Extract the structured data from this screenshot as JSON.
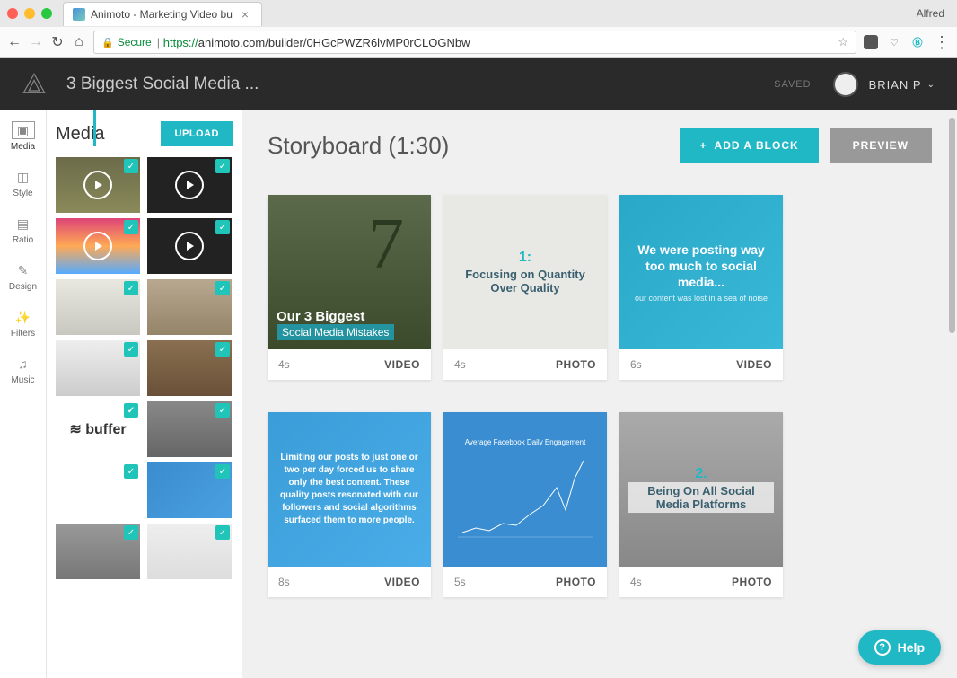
{
  "browser": {
    "tab_title": "Animoto - Marketing Video bu",
    "profile": "Alfred",
    "secure_label": "Secure",
    "url_scheme": "https://",
    "url_rest": "animoto.com/builder/0HGcPWZR6lvMP0rCLOGNbw"
  },
  "header": {
    "project_title": "3 Biggest Social Media ...",
    "saved_label": "SAVED",
    "username": "BRIAN P"
  },
  "leftnav": {
    "items": [
      {
        "label": "Media",
        "icon": "image-icon"
      },
      {
        "label": "Style",
        "icon": "frame-icon"
      },
      {
        "label": "Ratio",
        "icon": "ratio-icon"
      },
      {
        "label": "Design",
        "icon": "brush-icon"
      },
      {
        "label": "Filters",
        "icon": "wand-icon"
      },
      {
        "label": "Music",
        "icon": "music-icon"
      }
    ]
  },
  "media_panel": {
    "title": "Media",
    "upload_label": "UPLOAD",
    "thumbs": [
      {
        "type": "video",
        "cls": "t-film"
      },
      {
        "type": "video",
        "cls": "t-dark"
      },
      {
        "type": "video",
        "cls": "t-warm"
      },
      {
        "type": "video",
        "cls": "t-dark"
      },
      {
        "type": "photo",
        "cls": "t-room"
      },
      {
        "type": "photo",
        "cls": "t-desk"
      },
      {
        "type": "photo",
        "cls": "t-laptop"
      },
      {
        "type": "photo",
        "cls": "t-wood"
      },
      {
        "type": "photo",
        "cls": "t-buffer",
        "text": "≋ buffer"
      },
      {
        "type": "photo",
        "cls": "t-office"
      },
      {
        "type": "photo",
        "cls": "t-data"
      },
      {
        "type": "photo",
        "cls": "t-chart"
      },
      {
        "type": "photo",
        "cls": "t-desk2"
      },
      {
        "type": "photo",
        "cls": "t-cup"
      }
    ]
  },
  "storyboard": {
    "title": "Storyboard (1:30)",
    "add_block_label": "ADD A BLOCK",
    "preview_label": "PREVIEW",
    "cards": [
      {
        "duration": "4s",
        "type": "VIDEO",
        "title_line1": "Our 3 Biggest",
        "title_line2": "Social Media Mistakes"
      },
      {
        "duration": "4s",
        "type": "PHOTO",
        "num": "1:",
        "text": "Focusing on Quantity Over Quality"
      },
      {
        "duration": "6s",
        "type": "VIDEO",
        "headline": "We were posting way too much to social media...",
        "sub": "our content was lost in a sea of noise"
      },
      {
        "duration": "8s",
        "type": "VIDEO",
        "text": "Limiting our posts to just one or two per day forced us to share only the best content. These quality posts resonated with our followers and social algorithms surfaced them to more people."
      },
      {
        "duration": "5s",
        "type": "PHOTO",
        "chart_title": "Average Facebook Daily Engagement"
      },
      {
        "duration": "4s",
        "type": "PHOTO",
        "num": "2.",
        "text": "Being On All Social Media Platforms"
      }
    ]
  },
  "help": {
    "label": "Help"
  }
}
